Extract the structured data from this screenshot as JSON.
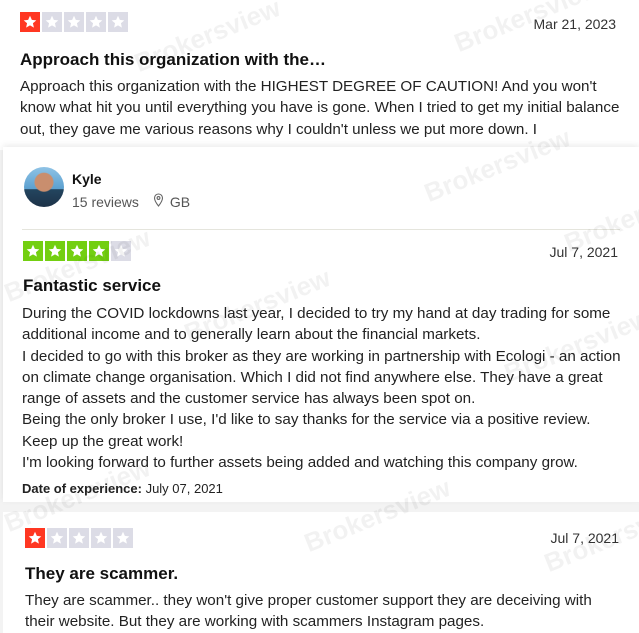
{
  "watermark": "Brokersview",
  "reviews": [
    {
      "rating": 1,
      "date": "Mar 21, 2023",
      "title": "Approach this organization with the…",
      "body": "Approach this organization with the HIGHEST DEGREE OF CAUTION! And you won't know what hit you until everything you have is gone. When I tried to get my initial balance out, they gave me various reasons why I couldn't unless we put more down. I"
    },
    {
      "reviewer": {
        "name": "Kyle",
        "reviews": "15 reviews",
        "country": "GB"
      },
      "rating": 4,
      "date": "Jul 7, 2021",
      "title": "Fantastic service",
      "body_lines": [
        "During the COVID lockdowns last year, I decided to try my hand at day trading for some additional income and to generally learn about the financial markets.",
        "I decided to go with this broker as they are working in partnership with Ecologi - an action on climate change organisation. Which I did not find anywhere else. They have a great range of assets and the customer service has always been spot on.",
        "Being the only broker I use, I'd like to say thanks for the service via a positive review. Keep up the great work!",
        "I'm looking forward to further assets being added and watching this company grow."
      ],
      "experience_label": "Date of experience:",
      "experience_date": "July 07, 2021"
    },
    {
      "rating": 1,
      "date": "Jul 7, 2021",
      "title": "They are scammer.",
      "body": "They are scammer.. they won't give proper customer support they are deceiving with their website. But they are working with scammers Instagram pages."
    }
  ],
  "colors": {
    "one_star": "#ff3722",
    "four_star": "#73cf11",
    "empty_star": "#dcdce6"
  }
}
